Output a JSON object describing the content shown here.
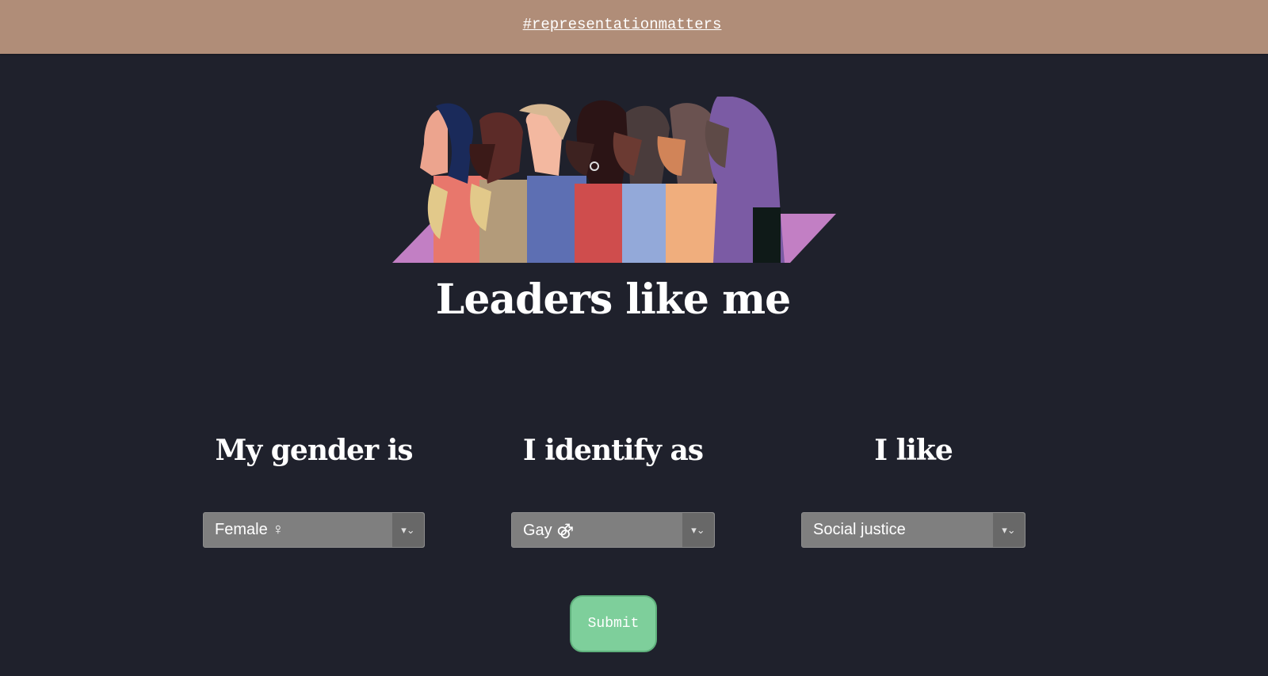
{
  "header": {
    "hashtag_link": "#representationmatters"
  },
  "hero": {
    "image": "diverse-people-profile-illustration"
  },
  "page": {
    "title": "Leaders like me"
  },
  "filters": {
    "gender": {
      "label": "My gender is",
      "selected": "Female ♀"
    },
    "identity": {
      "label": "I identify as",
      "selected": "Gay ⚣"
    },
    "interest": {
      "label": "I like",
      "selected": "Social justice"
    }
  },
  "form": {
    "submit_label": "Submit"
  },
  "colors": {
    "header_bg": "#b08d78",
    "page_bg": "#1f212c",
    "select_bg": "#7f7f7f",
    "submit_bg": "#7ecf9b"
  }
}
